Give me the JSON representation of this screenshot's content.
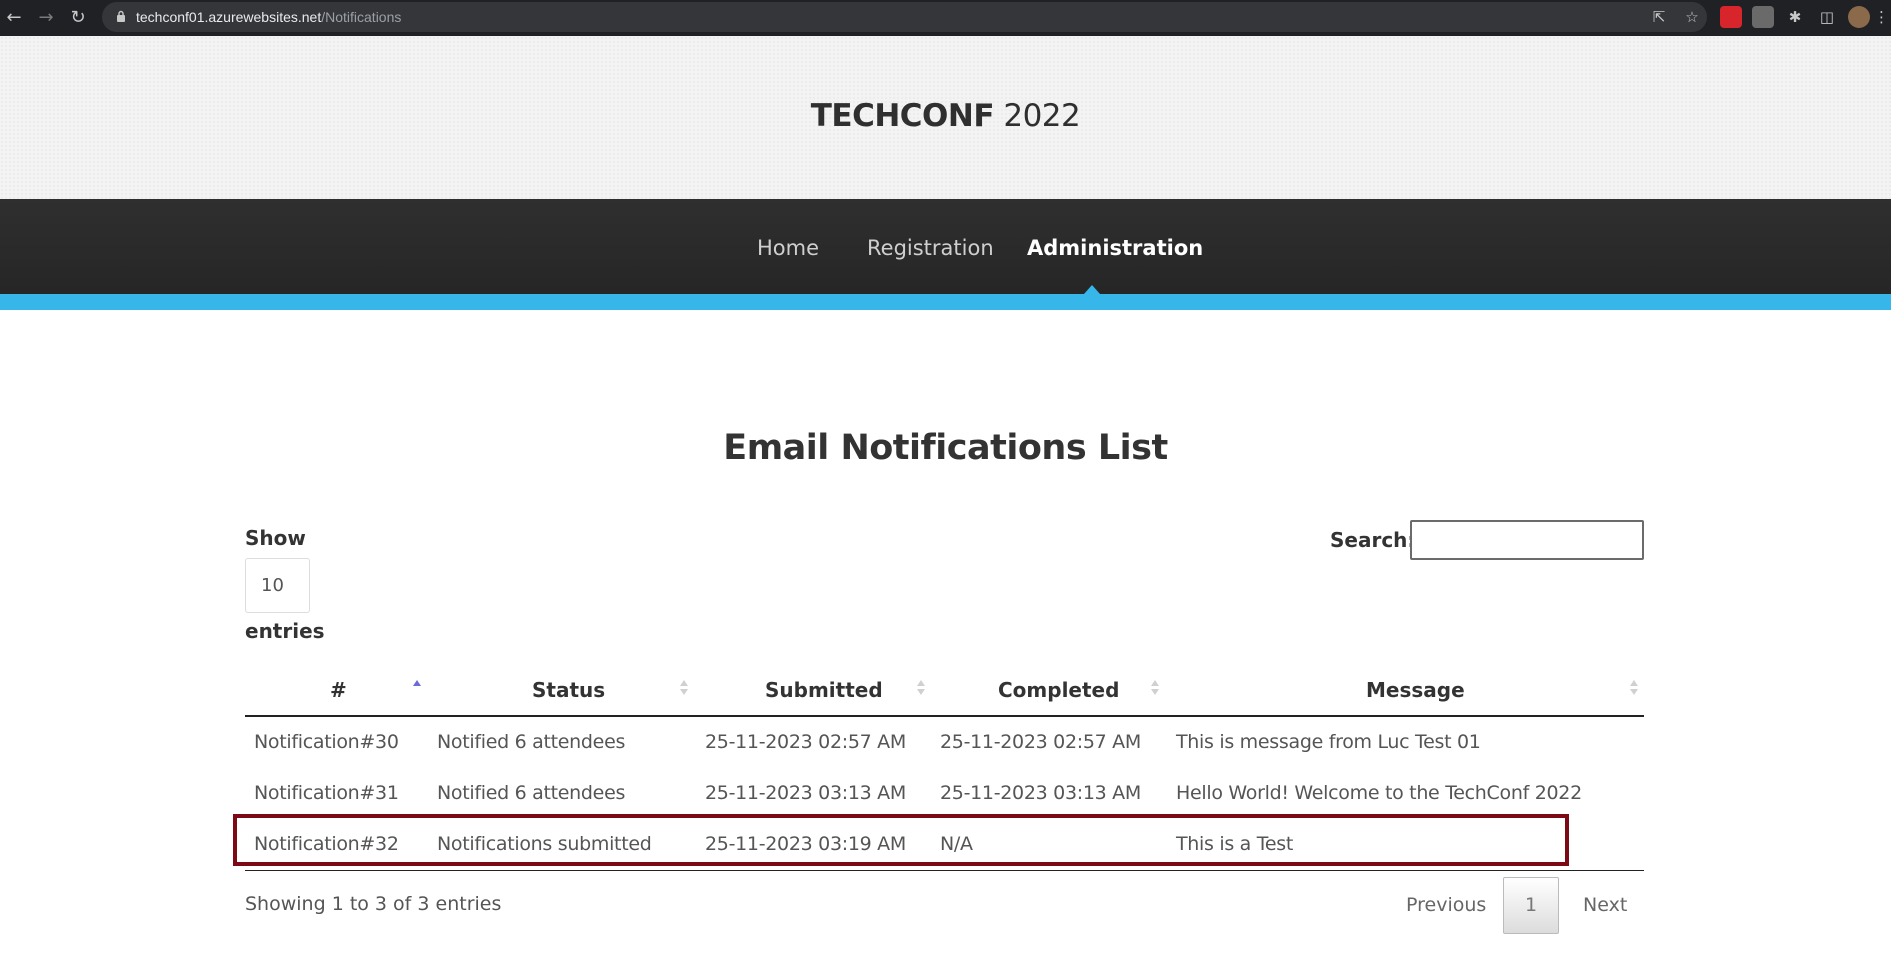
{
  "browser": {
    "url_host": "techconf01.azurewebsites.net",
    "url_path": "/Notifications",
    "back_icon": "back-arrow-icon",
    "forward_icon": "forward-arrow-icon",
    "reload_icon": "reload-icon"
  },
  "header": {
    "brand_bold": "TECHCONF",
    "brand_year": " 2022"
  },
  "nav": {
    "items": [
      {
        "label": "Home"
      },
      {
        "label": "Registration"
      },
      {
        "label": "Administration",
        "active": true
      }
    ],
    "accent_color": "#37b6ea"
  },
  "page": {
    "title": "Email Notifications List"
  },
  "table_controls": {
    "show_label": "Show",
    "length_value": "10",
    "entries_label": "entries",
    "search_label": "Search:",
    "search_value": ""
  },
  "table": {
    "columns": [
      "#",
      "Status",
      "Submitted",
      "Completed",
      "Message"
    ],
    "rows": [
      [
        "Notification#30",
        "Notified 6 attendees",
        "25-11-2023 02:57 AM",
        "25-11-2023 02:57 AM",
        "This is message from Luc Test 01"
      ],
      [
        "Notification#31",
        "Notified 6 attendees",
        "25-11-2023 03:13 AM",
        "25-11-2023 03:13 AM",
        "Hello World! Welcome to the TechConf 2022"
      ],
      [
        "Notification#32",
        "Notifications submitted",
        "25-11-2023 03:19 AM",
        "N/A",
        "This is a Test"
      ]
    ],
    "highlight_color": "#7b0a16"
  },
  "footer": {
    "info": "Showing 1 to 3 of 3 entries",
    "previous": "Previous",
    "current_page": "1",
    "next": "Next"
  }
}
